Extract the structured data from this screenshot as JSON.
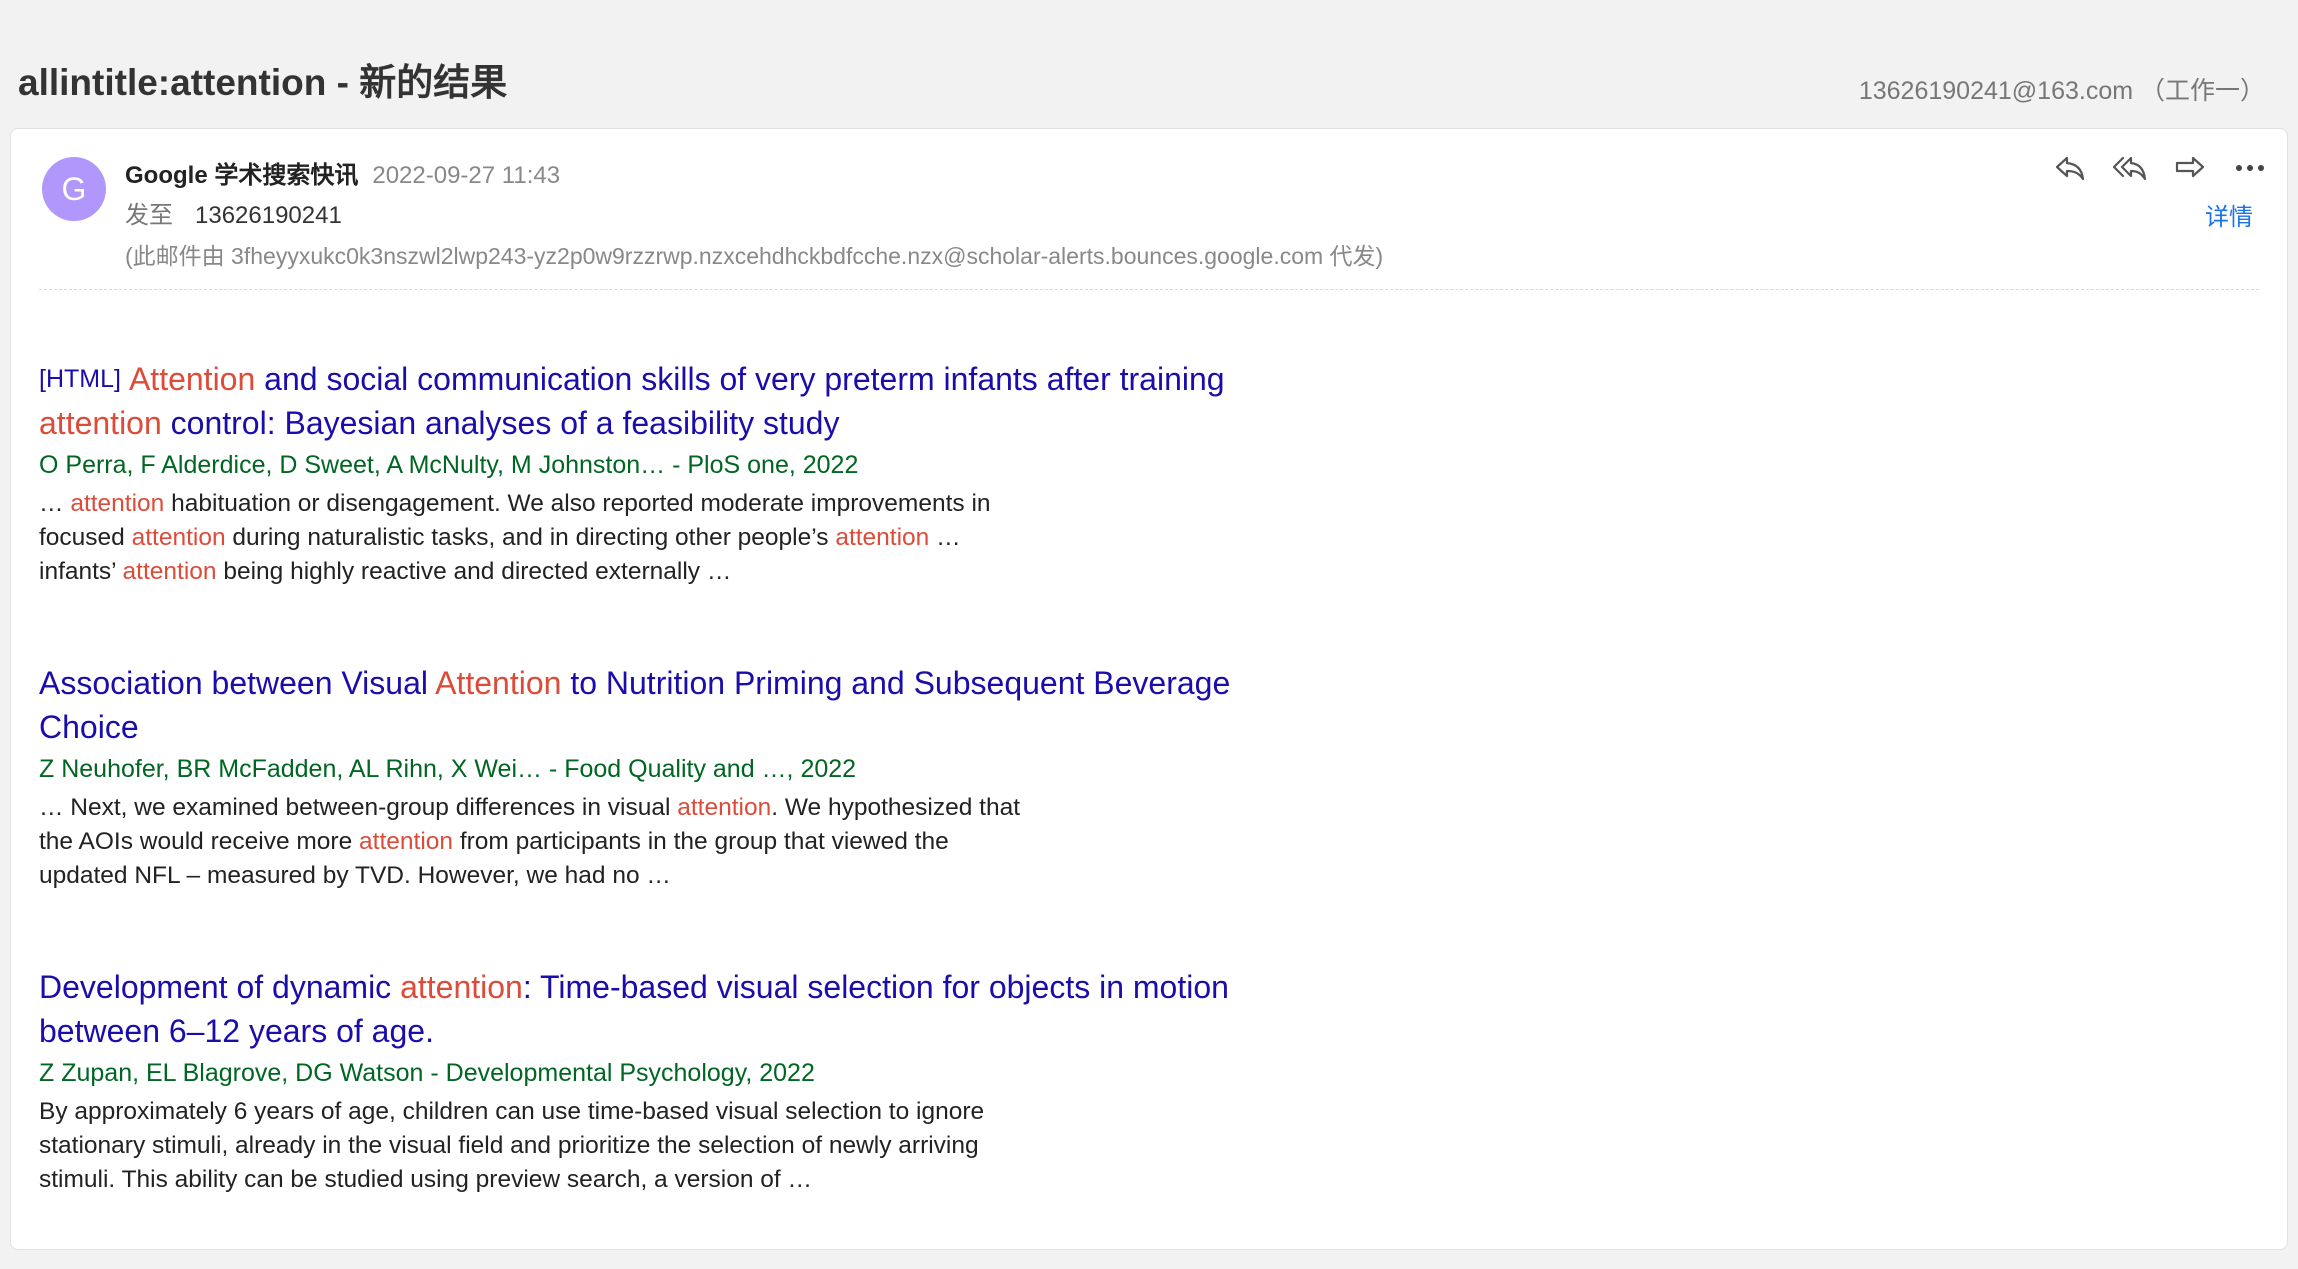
{
  "header": {
    "subject": "allintitle:attention - 新的结果",
    "account": "13626190241@163.com （工作一）"
  },
  "message": {
    "avatar_letter": "G",
    "avatar_color": "#b197fc",
    "sender": "Google 学术搜索快讯",
    "time": "2022-09-27 11:43",
    "to_label": "发至",
    "to": "13626190241",
    "proxy_note": "(此邮件由 3fheyyxukc0k3nszwl2lwp243-yz2p0w9rzzrwp.nzxcehdhckbdfcche.nzx@scholar-alerts.bounces.google.com 代发)",
    "details_label": "详情",
    "actions": [
      "reply-icon",
      "reply-all-icon",
      "forward-icon",
      "more-icon"
    ]
  },
  "results": [
    {
      "tag": "[HTML]",
      "title": {
        "p1": "Attention",
        "p2": " and social communication skills of very preterm infants after training ",
        "p3": "attention",
        "p4": " control: Bayesian analyses of a feasibility study"
      },
      "authors": "O Perra, F Alderdice, D Sweet, A McNulty, M Johnston… - PloS one, 2022",
      "snippet": {
        "s1": "… ",
        "s2": "attention",
        "s3": " habituation or disengagement. We also reported moderate improvements in focused ",
        "s4": "attention",
        "s5": " during naturalistic tasks, and in directing other people’s ",
        "s6": "attention",
        "s7": " … infants’ ",
        "s8": "attention",
        "s9": " being highly reactive and directed externally …"
      }
    },
    {
      "title": {
        "p1": "Association between Visual ",
        "p2": "Attention",
        "p3": " to Nutrition Priming and Subsequent Beverage Choice"
      },
      "authors": "Z Neuhofer, BR McFadden, AL Rihn, X Wei… - Food Quality and …, 2022",
      "snippet": {
        "s1": "… Next, we examined between-group differences in visual ",
        "s2": "attention",
        "s3": ". We hypothesized that the AOIs would receive more ",
        "s4": "attention",
        "s5": " from participants in the group that viewed the updated NFL – measured by TVD. However, we had no …"
      }
    },
    {
      "title": {
        "p1": "Development of dynamic ",
        "p2": "attention",
        "p3": ": Time-based visual selection for objects in motion between 6–12 years of age."
      },
      "authors": "Z Zupan, EL Blagrove, DG Watson - Developmental Psychology, 2022",
      "snippet": {
        "s1": "By approximately 6 years of age, children can use time-based visual selection to ignore stationary stimuli, already in the visual field and prioritize the selection of newly arriving stimuli. This ability can be studied using preview search, a version of …"
      }
    }
  ],
  "colors": {
    "link": "#1a0dab",
    "highlight": "#dd4b39",
    "authors": "#006621",
    "details": "#1a73e8"
  }
}
